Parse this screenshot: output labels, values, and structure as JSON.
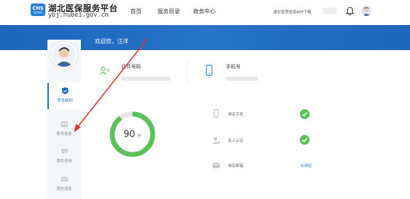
{
  "header": {
    "logo_text": "CHS",
    "logo_sub": "医疗保障",
    "site_title": "湖北医保服务平台",
    "site_url": "ybj.hubei.gov.cn",
    "nav": [
      "首页",
      "服务目录",
      "政务中心"
    ],
    "app_download": "湖北智慧医保APP下载"
  },
  "welcome": "欢迎您，汪洋",
  "sidebar": {
    "items": [
      {
        "label": "安全级别",
        "icon": "shield-icon",
        "active": true
      },
      {
        "label": "账号信息",
        "icon": "id-card-icon",
        "active": false
      },
      {
        "label": "我的咨询",
        "icon": "chat-icon",
        "active": false
      },
      {
        "label": "我的消息",
        "icon": "mail-icon",
        "active": false
      }
    ]
  },
  "account": {
    "id_label": "证件号码",
    "phone_label": "手机号"
  },
  "security": {
    "score": "90",
    "score_unit": "分",
    "rows": [
      {
        "label": "绑定手机",
        "status": "verified",
        "icon": "phone-icon"
      },
      {
        "label": "实人认证",
        "status": "verified",
        "icon": "person-icon"
      },
      {
        "label": "绑定邮箱",
        "status": "unbound",
        "icon": "mail-icon",
        "action": "去绑定"
      }
    ]
  },
  "colors": {
    "brand_blue": "#1e6ac0",
    "ring_green": "#5cc15a",
    "ring_track": "#e6e6e6",
    "annotation_red": "#e0342b"
  }
}
